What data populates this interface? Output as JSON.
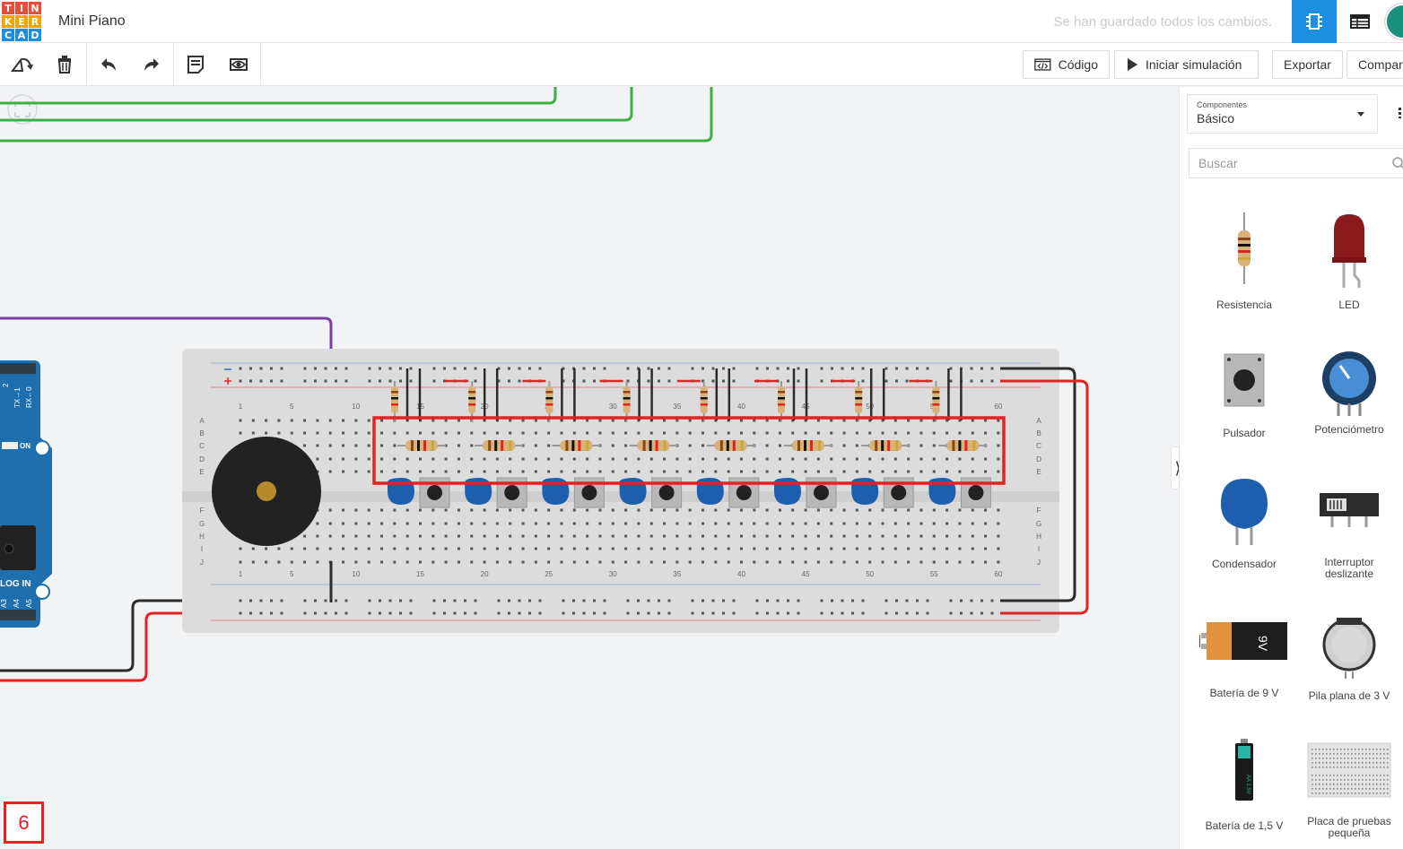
{
  "app": {
    "logo_letters": [
      "T",
      "I",
      "N",
      "K",
      "E",
      "R",
      "C",
      "A",
      "D"
    ],
    "logo_colors": [
      "#e54f3a",
      "#e54f3a",
      "#e54f3a",
      "#f0a30a",
      "#f0a30a",
      "#f0a30a",
      "#1d8ee0",
      "#1d8ee0",
      "#1d8ee0"
    ],
    "project_title": "Mini Piano",
    "save_status": "Se han guardado todos los cambios."
  },
  "toolbar": {
    "code_label": "Código",
    "simulate_label": "Iniciar simulación",
    "export_label": "Exportar",
    "share_label": "Compartir"
  },
  "panel": {
    "select_caption": "Componentes",
    "select_value": "Básico",
    "search_placeholder": "Buscar",
    "components": [
      {
        "label": "Resistencia",
        "icon": "resistor-icon"
      },
      {
        "label": "LED",
        "icon": "led-icon"
      },
      {
        "label": "Pulsador",
        "icon": "pushbutton-icon"
      },
      {
        "label": "Potenciómetro",
        "icon": "potentiometer-icon"
      },
      {
        "label": "Condensador",
        "icon": "capacitor-icon"
      },
      {
        "label": "Interruptor deslizante",
        "icon": "slide-switch-icon"
      },
      {
        "label": "Batería de 9 V",
        "icon": "battery-9v-icon"
      },
      {
        "label": "Pila plana de 3 V",
        "icon": "coin-cell-icon"
      },
      {
        "label": "Batería de 1,5 V",
        "icon": "battery-aa-icon"
      },
      {
        "label": "Placa de pruebas pequeña",
        "icon": "breadboard-small-icon"
      }
    ]
  },
  "canvas": {
    "column_numbers": [
      "1",
      "5",
      "10",
      "15",
      "20",
      "25",
      "30",
      "35",
      "40",
      "45",
      "50",
      "55",
      "60"
    ],
    "row_letters_top": [
      "A",
      "B",
      "C",
      "D",
      "E"
    ],
    "row_letters_bottom": [
      "F",
      "G",
      "H",
      "I",
      "J"
    ],
    "arduino_labels": [
      "ON",
      "LOG IN",
      "TX→1",
      "RX←0",
      "A3",
      "A4",
      "A5",
      "2"
    ],
    "battery_label": "9V"
  },
  "annotation": {
    "step_number": "6"
  }
}
